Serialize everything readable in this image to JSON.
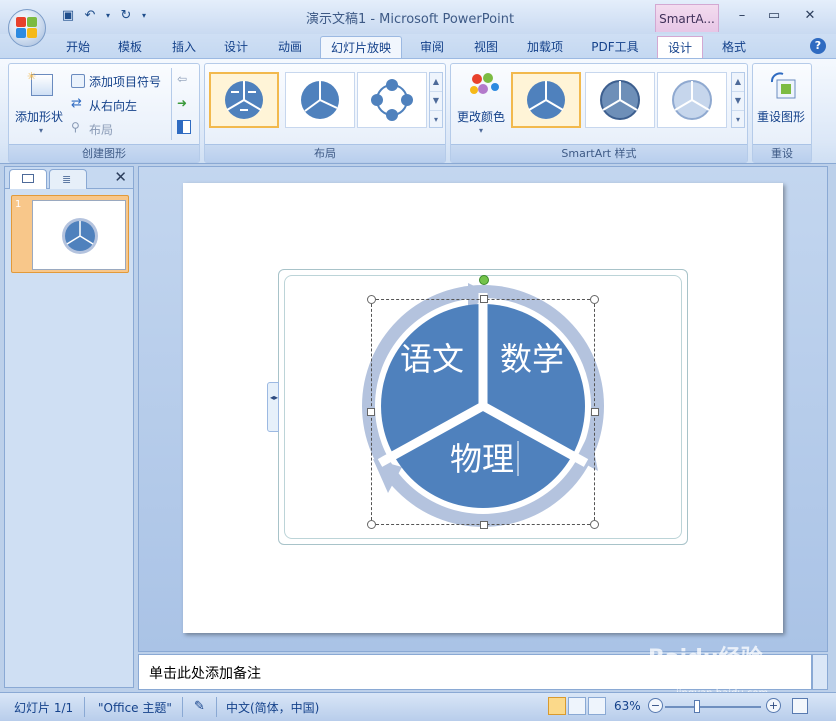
{
  "window": {
    "title": "演示文稿1 - Microsoft PowerPoint",
    "context_tool_title": "SmartA...",
    "min_glyph": "–",
    "max_glyph": "▭",
    "close_glyph": "✕"
  },
  "tabs": [
    {
      "label": "开始"
    },
    {
      "label": "模板"
    },
    {
      "label": "插入"
    },
    {
      "label": "设计"
    },
    {
      "label": "动画"
    },
    {
      "label": "幻灯片放映"
    },
    {
      "label": "审阅"
    },
    {
      "label": "视图"
    },
    {
      "label": "加载项"
    },
    {
      "label": "PDF工具"
    },
    {
      "label": "设计"
    },
    {
      "label": "格式"
    }
  ],
  "ribbon": {
    "create_group": {
      "label": "创建图形",
      "add_shape": "添加形状",
      "add_bullet": "添加项目符号",
      "right_to_left": "从右向左",
      "layout": "布局"
    },
    "layout_group": {
      "label": "布局"
    },
    "styles_group": {
      "label": "SmartArt 样式",
      "change_colors": "更改颜色"
    },
    "reset_group": {
      "label": "重设",
      "reset_graphic": "重设图形"
    }
  },
  "slide": {
    "thumbnail_number": "1",
    "diagram": {
      "segments": [
        {
          "text": "语文"
        },
        {
          "text": "数学"
        },
        {
          "text": "物理"
        }
      ]
    }
  },
  "notes": {
    "placeholder": "单击此处添加备注"
  },
  "status": {
    "slide_info": "幻灯片 1/1",
    "theme": "\"Office 主题\"",
    "language": "中文(简体，中国)",
    "zoom": "63%"
  },
  "watermark": {
    "brand": "Baidu经验",
    "url": "jingyan.baidu.com"
  },
  "colors": {
    "diagram_fill": "#4f81bd",
    "arrow_fill": "#b4c3de",
    "context_tab": "#e7c6e6",
    "ribbon_bg": "#dbe7f7"
  }
}
